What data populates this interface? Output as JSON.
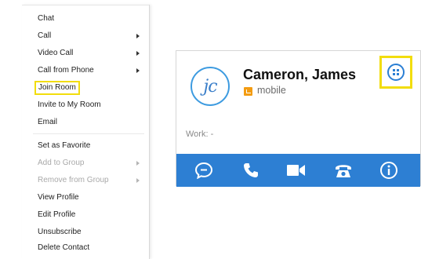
{
  "context_menu": {
    "items": [
      {
        "label": "Chat",
        "submenu": false,
        "disabled": false
      },
      {
        "label": "Call",
        "submenu": true,
        "disabled": false
      },
      {
        "label": "Video Call",
        "submenu": true,
        "disabled": false
      },
      {
        "label": "Call from Phone",
        "submenu": true,
        "disabled": false
      },
      {
        "label": "Join Room",
        "submenu": false,
        "disabled": false,
        "highlighted": true
      },
      {
        "label": "Invite to My Room",
        "submenu": false,
        "disabled": false
      },
      {
        "label": "Email",
        "submenu": false,
        "disabled": false
      },
      {
        "label": "Set as Favorite",
        "submenu": false,
        "disabled": false
      },
      {
        "label": "Add to Group",
        "submenu": true,
        "disabled": true
      },
      {
        "label": "Remove from Group",
        "submenu": true,
        "disabled": true
      },
      {
        "label": "View Profile",
        "submenu": false,
        "disabled": false
      },
      {
        "label": "Edit Profile",
        "submenu": false,
        "disabled": false
      },
      {
        "label": "Unsubscribe",
        "submenu": false,
        "disabled": false
      },
      {
        "label": "Delete Contact",
        "submenu": false,
        "disabled": false
      }
    ]
  },
  "contact_card": {
    "initials": "jc",
    "name": "Cameron, James",
    "status": "mobile",
    "work_label": "Work: -",
    "actions": [
      "chat-icon",
      "phone-icon",
      "video-icon",
      "desk-phone-icon",
      "info-icon"
    ]
  },
  "colors": {
    "highlight": "#f2dd0d",
    "accent_blue": "#2d7fd3",
    "presence_orange": "#f39c12"
  }
}
